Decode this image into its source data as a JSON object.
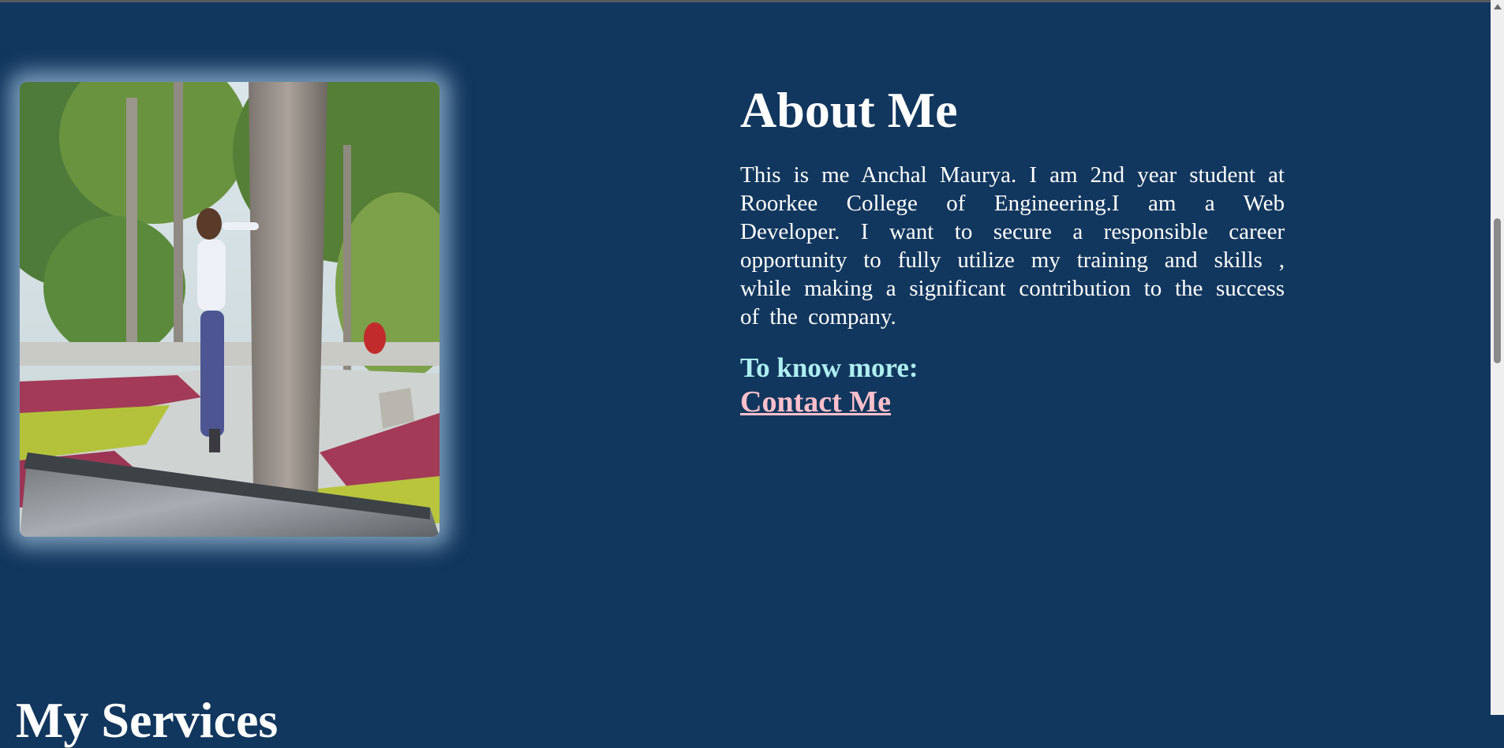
{
  "about": {
    "heading": "About Me",
    "bio": "This is me Anchal Maurya. I am 2nd year student at Roorkee College of Engineering.I am a Web Developer. I want to secure a responsible career opportunity to fully utilize my training and skills , while making a significant contribution to the success of the company.",
    "more_label": "To know more:",
    "contact_link": "Contact Me"
  },
  "services": {
    "heading": "My Services"
  },
  "colors": {
    "background": "#12375e",
    "text": "#ffffff",
    "more_label": "#aeeef0",
    "contact_link": "#ffc0cb"
  }
}
